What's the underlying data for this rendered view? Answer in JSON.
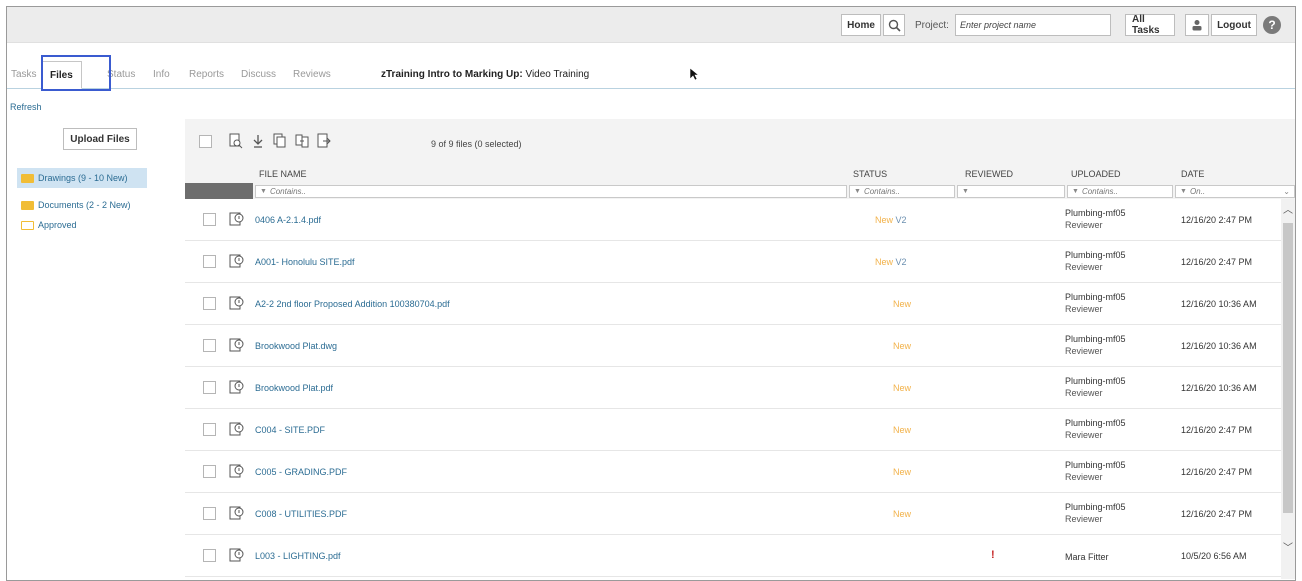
{
  "topbar": {
    "home_label": "Home",
    "project_label": "Project:",
    "project_placeholder": "Enter project name",
    "all_tasks_label": "All Tasks",
    "logout_label": "Logout",
    "help_glyph": "?"
  },
  "tabs": [
    {
      "label": "Tasks"
    },
    {
      "label": "Files"
    },
    {
      "label": "Status"
    },
    {
      "label": "Info"
    },
    {
      "label": "Reports"
    },
    {
      "label": "Discuss"
    },
    {
      "label": "Reviews"
    }
  ],
  "course": {
    "title": "zTraining Intro to Marking Up:",
    "subtitle": "Video Training"
  },
  "refresh_label": "Refresh",
  "upload_label": "Upload Files",
  "folders": [
    {
      "label": "Drawings (9 - 10 New)",
      "selected": true
    },
    {
      "label": "Documents (2 - 2 New)",
      "selected": false
    },
    {
      "label": "Approved",
      "selected": false
    }
  ],
  "grid": {
    "count_text": "9 of 9 files (0 selected)",
    "headers": {
      "file_name": "FILE NAME",
      "status": "STATUS",
      "reviewed": "REVIEWED",
      "uploaded": "UPLOADED",
      "date": "DATE"
    },
    "filters": {
      "file_name": "Contains..",
      "status": "Contains..",
      "reviewed": "",
      "uploaded": "Contains..",
      "date": "On.."
    },
    "rows": [
      {
        "name": "0406 A-2.1.4.pdf",
        "status": "New",
        "version": "V2",
        "reviewed": "",
        "uploaded_1": "Plumbing-mf05",
        "uploaded_2": "Reviewer",
        "date": "12/16/20 2:47 PM"
      },
      {
        "name": "A001- Honolulu SITE.pdf",
        "status": "New",
        "version": "V2",
        "reviewed": "",
        "uploaded_1": "Plumbing-mf05",
        "uploaded_2": "Reviewer",
        "date": "12/16/20 2:47 PM"
      },
      {
        "name": "A2-2 2nd floor Proposed Addition 100380704.pdf",
        "status": "New",
        "version": "",
        "reviewed": "",
        "uploaded_1": "Plumbing-mf05",
        "uploaded_2": "Reviewer",
        "date": "12/16/20 10:36 AM"
      },
      {
        "name": "Brookwood Plat.dwg",
        "status": "New",
        "version": "",
        "reviewed": "",
        "uploaded_1": "Plumbing-mf05",
        "uploaded_2": "Reviewer",
        "date": "12/16/20 10:36 AM"
      },
      {
        "name": "Brookwood Plat.pdf",
        "status": "New",
        "version": "",
        "reviewed": "",
        "uploaded_1": "Plumbing-mf05",
        "uploaded_2": "Reviewer",
        "date": "12/16/20 10:36 AM"
      },
      {
        "name": "C004 - SITE.PDF",
        "status": "New",
        "version": "",
        "reviewed": "",
        "uploaded_1": "Plumbing-mf05",
        "uploaded_2": "Reviewer",
        "date": "12/16/20 2:47 PM"
      },
      {
        "name": "C005 - GRADING.PDF",
        "status": "New",
        "version": "",
        "reviewed": "",
        "uploaded_1": "Plumbing-mf05",
        "uploaded_2": "Reviewer",
        "date": "12/16/20 2:47 PM"
      },
      {
        "name": "C008 - UTILITIES.PDF",
        "status": "New",
        "version": "",
        "reviewed": "",
        "uploaded_1": "Plumbing-mf05",
        "uploaded_2": "Reviewer",
        "date": "12/16/20 2:47 PM"
      },
      {
        "name": "L003 - LIGHTING.pdf",
        "status": "",
        "version": "",
        "reviewed": "!",
        "uploaded_1": "Mara Fitter",
        "uploaded_2": "",
        "date": "10/5/20 6:56 AM"
      }
    ]
  },
  "colors": {
    "link": "#2b6c93",
    "new_status": "#f2b24a",
    "highlight": "#3a5bd0",
    "selected_folder": "#cfe3f2"
  }
}
